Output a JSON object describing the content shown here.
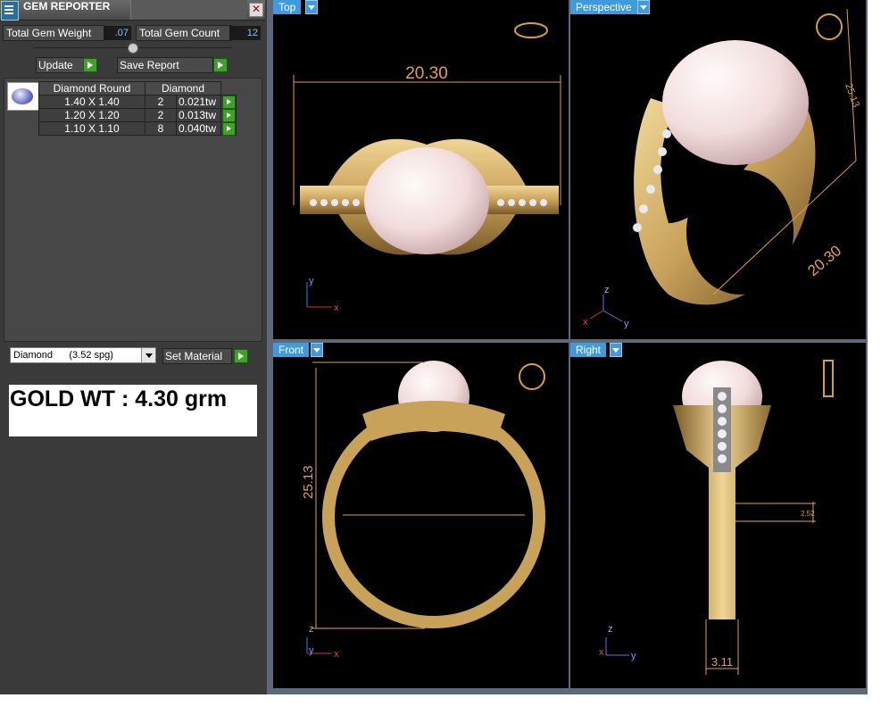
{
  "app": {
    "title": "GEM REPORTER",
    "close_glyph": "✕"
  },
  "summary": {
    "weight_label": "Total Gem Weight",
    "weight_value": ".07",
    "count_label": "Total Gem Count",
    "count_value": "12"
  },
  "actions": {
    "update_label": "Update",
    "save_label": "Save Report",
    "set_material_label": "Set Material"
  },
  "gem_table": {
    "headers": [
      "Diamond Round",
      "Diamond"
    ],
    "rows": [
      {
        "size": "1.40 X 1.40",
        "count": "2",
        "weight": "0.021tw"
      },
      {
        "size": "1.20 X 1.20",
        "count": "2",
        "weight": "0.013tw"
      },
      {
        "size": "1.10 X 1.10",
        "count": "8",
        "weight": "0.040tw"
      }
    ]
  },
  "material": {
    "selected": "Diamond      (3.52 spg)"
  },
  "gold_weight": "GOLD WT : 4.30 grm",
  "viewports": {
    "top": {
      "label": "Top",
      "dimension": "20.30"
    },
    "perspective": {
      "label": "Perspective",
      "dimension_a": "20.30",
      "dimension_b": "25.13"
    },
    "front": {
      "label": "Front",
      "dimension": "25.13"
    },
    "right": {
      "label": "Right",
      "dimension": "3.11",
      "dimension_small": "2.52"
    }
  },
  "axes": {
    "x": "x",
    "y": "y",
    "z": "z"
  },
  "colors": {
    "gold": "#c9a25a",
    "pearl": "#f2dcdc",
    "tab_blue": "#3f9bdc",
    "dimension": "#e0a050",
    "accent_green": "#3fa12a"
  }
}
